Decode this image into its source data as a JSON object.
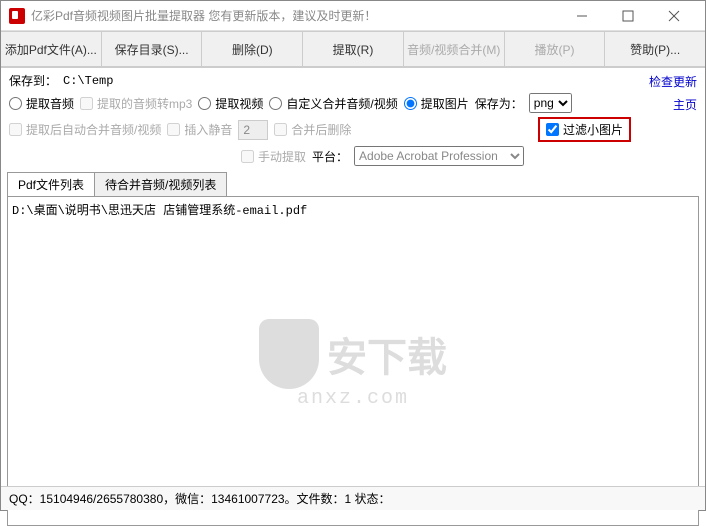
{
  "window": {
    "title": "亿彩Pdf音频视频图片批量提取器   您有更新版本，建议及时更新！"
  },
  "toolbar": {
    "addFile": "添加Pdf文件(A)...",
    "saveDir": "保存目录(S)...",
    "delete": "删除(D)",
    "extract": "提取(R)",
    "merge": "音频/视频合并(M)",
    "play": "播放(P)",
    "sponsor": "赞助(P)..."
  },
  "saveTo": {
    "label": "保存到：",
    "path": "C:\\Temp"
  },
  "options": {
    "extractAudio": "提取音频",
    "extractAudioMp3": "提取的音频转mp3",
    "extractVideo": "提取视频",
    "customMerge": "自定义合并音频/视频",
    "extractImage": "提取图片",
    "saveAs": "保存为：",
    "saveAsFormat": "png",
    "autoMergeAfter": "提取后自动合并音频/视频",
    "insertSilence": "插入静音",
    "silenceValue": "2",
    "deleteAfterMerge": "合并后删除",
    "filterSmallImage": "过滤小图片",
    "manualExtract": "手动提取",
    "platform": "平台：",
    "platformValue": "Adobe Acrobat Profession"
  },
  "links": {
    "checkUpdate": "检查更新",
    "homepage": "主页"
  },
  "tabs": {
    "fileList": "Pdf文件列表",
    "mergeList": "待合并音频/视频列表"
  },
  "fileList": {
    "item1": "D:\\桌面\\说明书\\思迅天店 店铺管理系统-email.pdf"
  },
  "watermark": {
    "text": "安下载",
    "sub": "anxz.com"
  },
  "status": {
    "qq": "QQ：15104946/2655780380，微信：13461007723。文件数：1  状态："
  }
}
